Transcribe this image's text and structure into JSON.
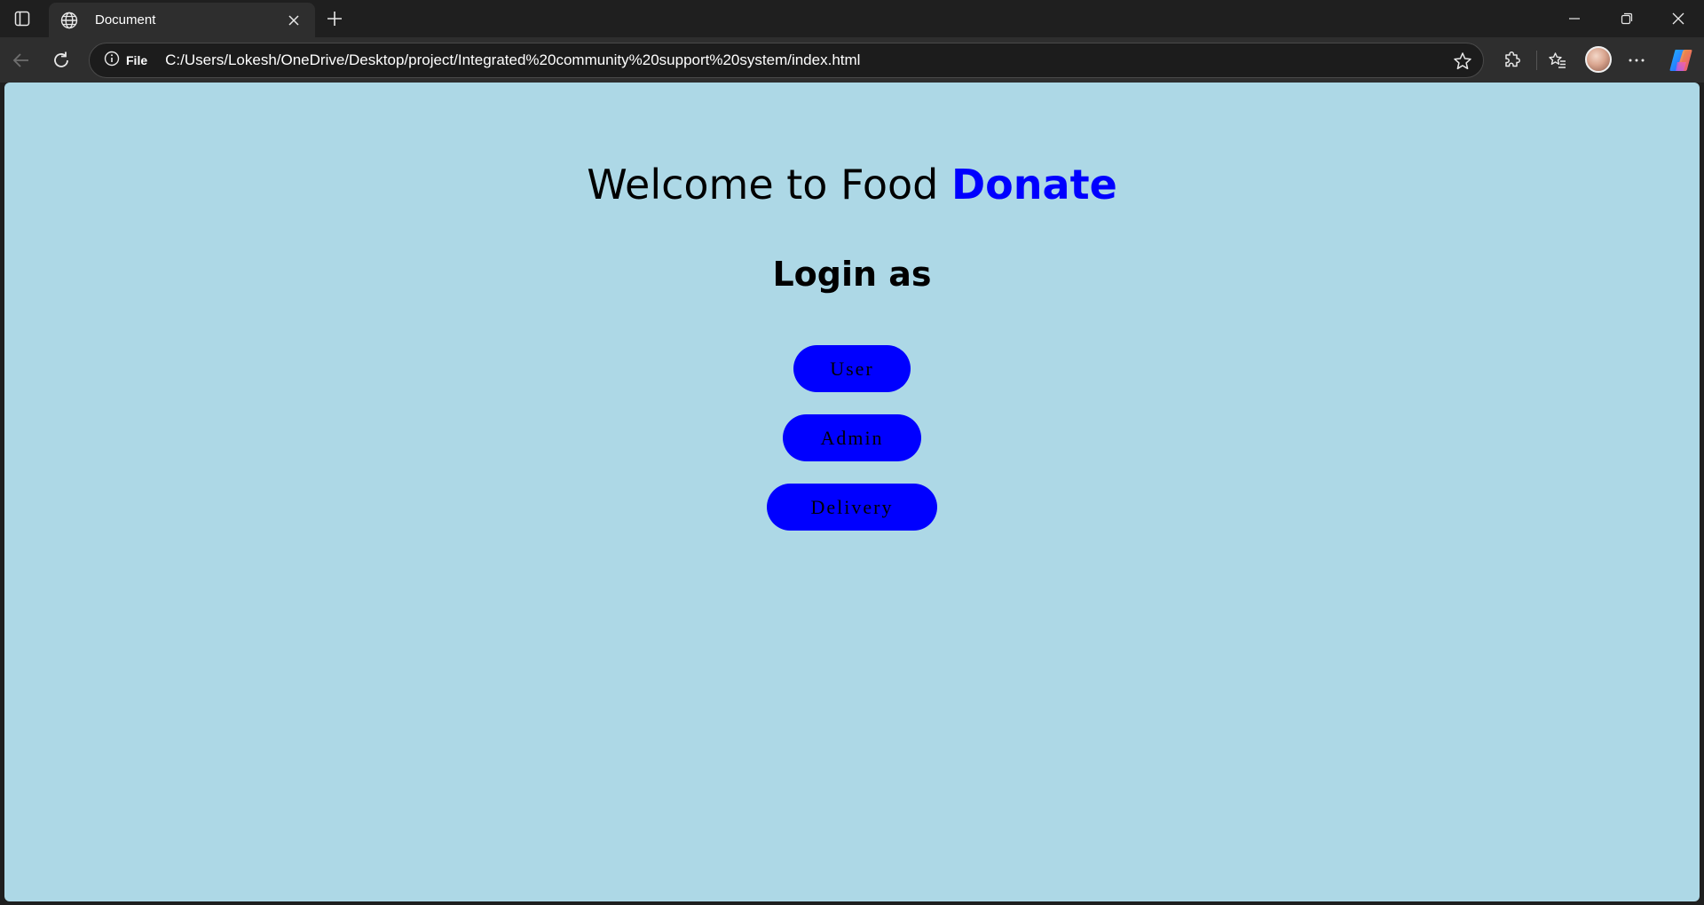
{
  "browser": {
    "tab": {
      "title": "Document",
      "favicon": "globe-icon"
    },
    "address_bar": {
      "site_info_label": "File",
      "url": "C:/Users/Lokesh/OneDrive/Desktop/project/Integrated%20community%20support%20system/index.html"
    },
    "icons": [
      "tab-actions-icon",
      "globe-icon",
      "close-icon",
      "plus-icon",
      "minimize-icon",
      "restore-icon",
      "window-close-icon",
      "back-arrow-icon",
      "refresh-icon",
      "info-icon",
      "star-icon",
      "extensions-icon",
      "favorites-icon",
      "avatar",
      "more-icon",
      "copilot-icon"
    ]
  },
  "page": {
    "background": "#add8e6",
    "heading": {
      "text": "Welcome to Food ",
      "accent": "Donate",
      "accent_color": "#0000ff"
    },
    "subheading": "Login as",
    "buttons": {
      "user": "User",
      "admin": "Admin",
      "delivery": "Delivery",
      "color": "#0000ff"
    }
  }
}
